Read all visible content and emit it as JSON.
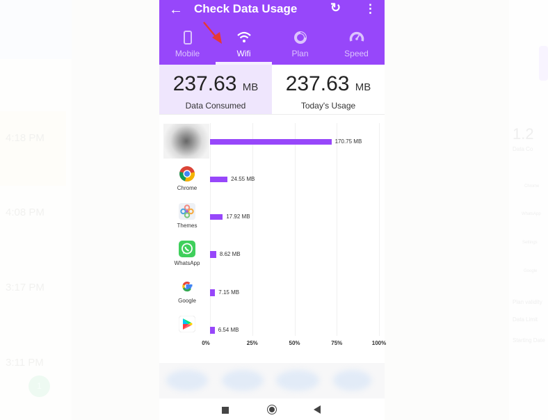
{
  "background": {
    "left_times": [
      "4:18 PM",
      "4:08 PM",
      "3:17 PM",
      "3:11 PM"
    ],
    "left_badge": "1",
    "right_texts": [
      "1.2",
      "Data Co",
      "Chrome",
      "WhatsApp",
      "Settings",
      "Google",
      "Plan validity",
      "Data Limit",
      "Starting Date"
    ]
  },
  "appbar": {
    "title": "Check Data Usage",
    "back_icon": "arrow-back-icon",
    "refresh_icon": "refresh-icon",
    "more_icon": "more-vert-icon"
  },
  "tabs": [
    {
      "label": "Mobile",
      "icon": "phone-icon",
      "active": false
    },
    {
      "label": "Wifi",
      "icon": "wifi-icon",
      "active": true
    },
    {
      "label": "Plan",
      "icon": "donut-chart-icon",
      "active": false
    },
    {
      "label": "Speed",
      "icon": "speedometer-icon",
      "active": false
    }
  ],
  "stats": [
    {
      "value": "237.63",
      "unit": "MB",
      "label": "Data Consumed"
    },
    {
      "value": "237.63",
      "unit": "MB",
      "label": "Today's Usage"
    }
  ],
  "colors": {
    "accent": "#9747fa",
    "tab_inactive": "#dcc4fd",
    "selected_stat_bg": "#efe6fd"
  },
  "chart_data": {
    "type": "bar",
    "orientation": "horizontal",
    "categories": [
      "",
      "Chrome",
      "Themes",
      "WhatsApp",
      "Google",
      ""
    ],
    "values_mb": [
      170.75,
      24.55,
      17.92,
      8.62,
      7.15,
      6.54
    ],
    "value_labels": [
      "170.75 MB",
      "24.55 MB",
      "17.92 MB",
      "8.62 MB",
      "7.15 MB",
      "6.54 MB"
    ],
    "percent_of_total": [
      71.9,
      10.3,
      7.5,
      3.6,
      3.0,
      2.8
    ],
    "total_mb": 237.63,
    "x_ticks": [
      "0%",
      "25%",
      "50%",
      "75%",
      "100%"
    ],
    "xlim": [
      0,
      100
    ],
    "grid": true,
    "icons": [
      "blurred-app-icon",
      "chrome-icon",
      "themes-icon",
      "whatsapp-icon",
      "google-icon",
      "play-store-icon"
    ]
  },
  "navbar": {
    "recents_icon": "square-recents-icon",
    "home_icon": "circle-home-icon",
    "back_icon": "triangle-back-icon"
  }
}
